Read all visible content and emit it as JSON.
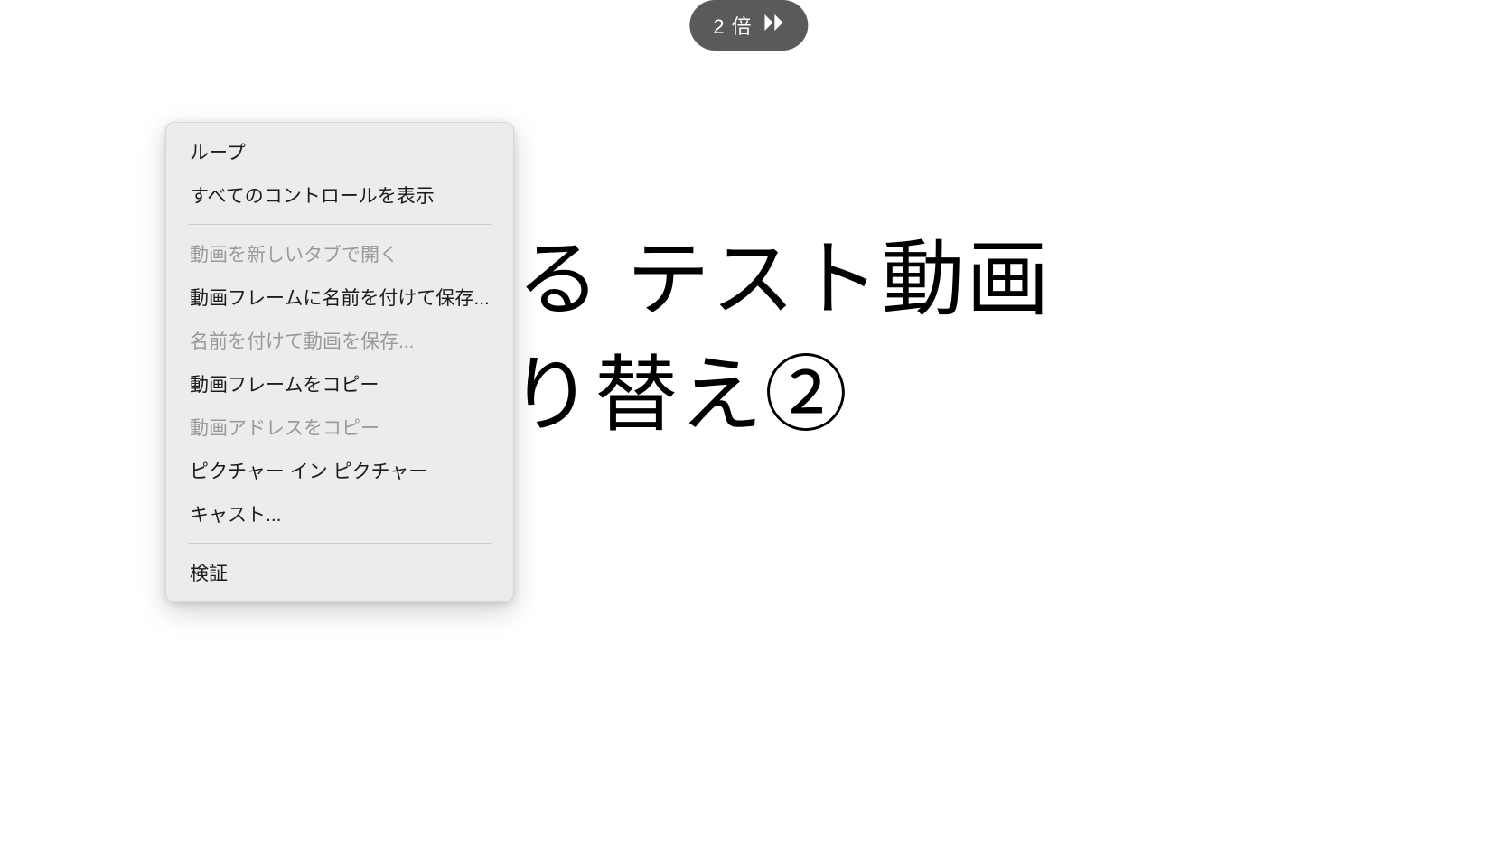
{
  "speed": {
    "label": "2 倍"
  },
  "video": {
    "line1": "る テスト動画",
    "line2": "り替え②"
  },
  "contextMenu": {
    "items": [
      {
        "label": "ループ",
        "disabled": false
      },
      {
        "label": "すべてのコントロールを表示",
        "disabled": false
      }
    ],
    "items2": [
      {
        "label": "動画を新しいタブで開く",
        "disabled": true
      },
      {
        "label": "動画フレームに名前を付けて保存...",
        "disabled": false
      },
      {
        "label": "名前を付けて動画を保存...",
        "disabled": true
      },
      {
        "label": "動画フレームをコピー",
        "disabled": false
      },
      {
        "label": "動画アドレスをコピー",
        "disabled": true
      },
      {
        "label": "ピクチャー イン ピクチャー",
        "disabled": false
      },
      {
        "label": "キャスト...",
        "disabled": false
      }
    ],
    "items3": [
      {
        "label": "検証",
        "disabled": false
      }
    ]
  }
}
